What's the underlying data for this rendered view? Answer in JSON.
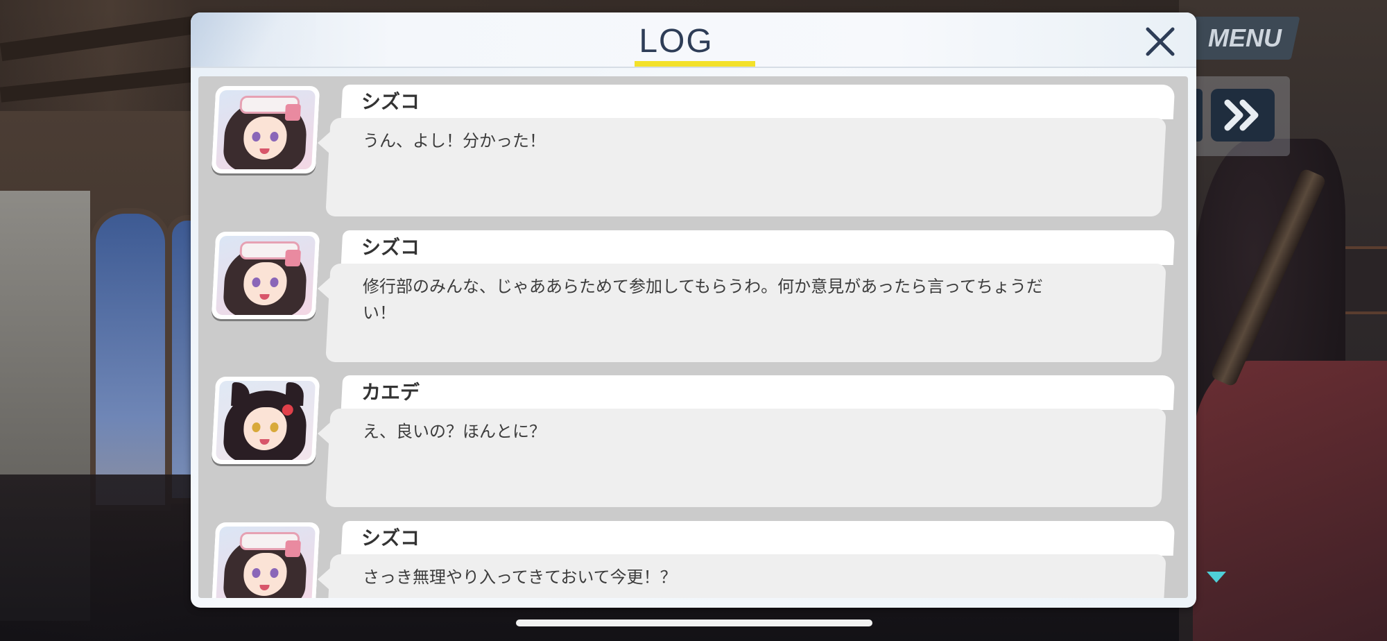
{
  "header": {
    "title": "LOG",
    "close_label": "close"
  },
  "hud": {
    "menu_label": "MENU",
    "fast_forward": "fast-forward-icon",
    "advance": "advance-indicator-icon"
  },
  "colors": {
    "title": "#2e3d57",
    "title_underline": "#f3e12a",
    "log_background": "#cbcbcb",
    "bubble": "#efefef",
    "menu_button": "#3d4955"
  },
  "log": {
    "entries": [
      {
        "speaker": "シズコ",
        "text": "うん、よし！分かった！"
      },
      {
        "speaker": "シズコ",
        "text": "修行部のみんな、じゃああらためて参加してもらうわ。何か意見があったら言ってちょうだ\nい！"
      },
      {
        "speaker": "カエデ",
        "text": "え、良いの？ほんとに？"
      },
      {
        "speaker": "シズコ",
        "text": "さっき無理やり入ってきておいて今更！？"
      }
    ]
  }
}
